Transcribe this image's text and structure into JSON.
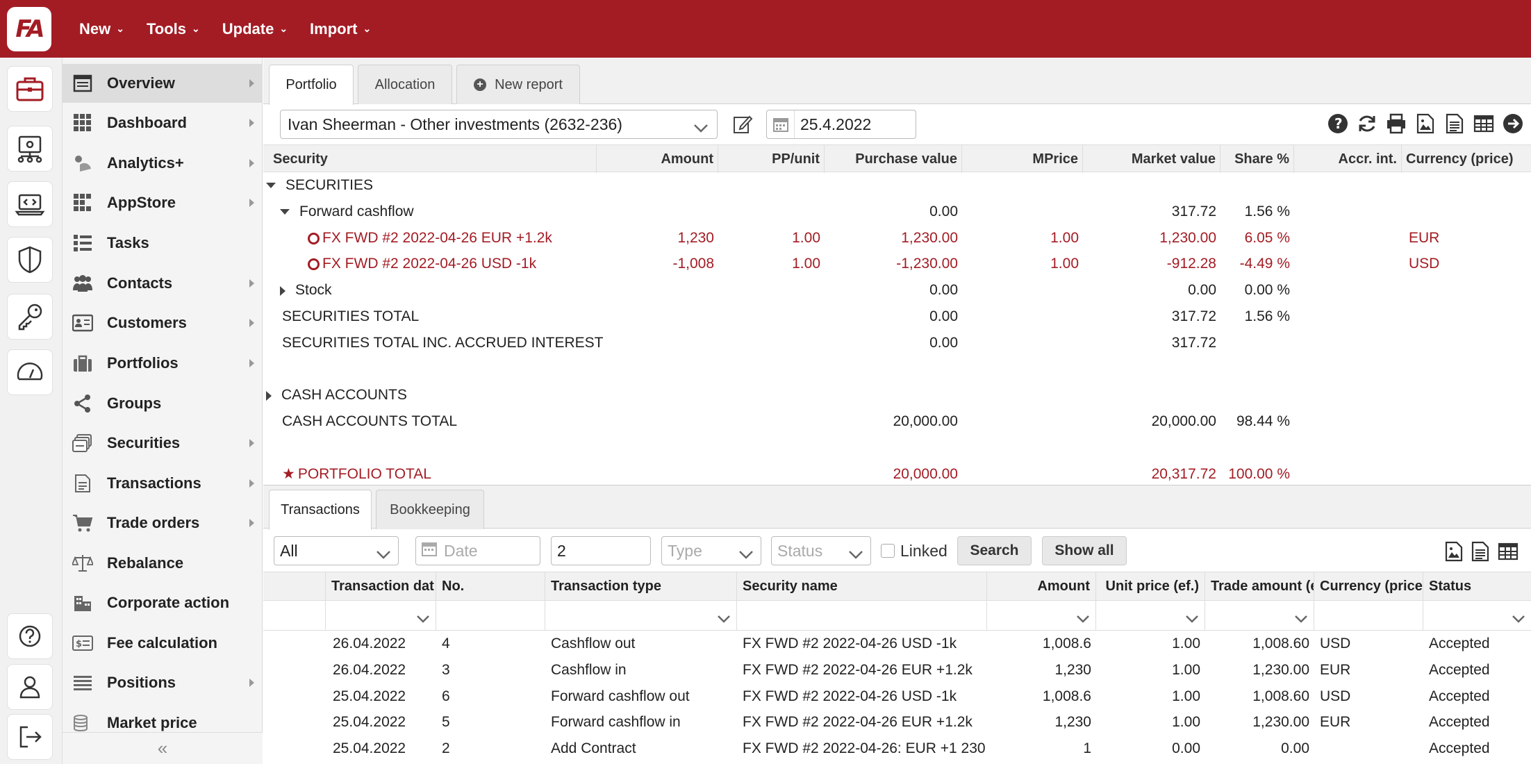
{
  "app": {
    "logo_text": "FA",
    "top_menu": [
      {
        "label": "New"
      },
      {
        "label": "Tools"
      },
      {
        "label": "Update"
      },
      {
        "label": "Import"
      }
    ]
  },
  "rail": {
    "items": [
      "briefcase-icon",
      "organization-icon",
      "code-laptop-icon",
      "shield-icon",
      "key-icon",
      "gauge-icon",
      "help-icon",
      "user-icon",
      "logout-icon"
    ]
  },
  "sidebar": {
    "items": [
      {
        "label": "Overview",
        "icon": "overview-icon",
        "arrow": true
      },
      {
        "label": "Dashboard",
        "icon": "dashboard-icon",
        "arrow": true
      },
      {
        "label": "Analytics+",
        "icon": "analytics-icon",
        "arrow": true
      },
      {
        "label": "AppStore",
        "icon": "appstore-icon",
        "arrow": true
      },
      {
        "label": "Tasks",
        "icon": "tasks-icon",
        "arrow": false
      },
      {
        "label": "Contacts",
        "icon": "contacts-icon",
        "arrow": true
      },
      {
        "label": "Customers",
        "icon": "customers-icon",
        "arrow": true
      },
      {
        "label": "Portfolios",
        "icon": "portfolios-icon",
        "arrow": true
      },
      {
        "label": "Groups",
        "icon": "groups-icon",
        "arrow": false
      },
      {
        "label": "Securities",
        "icon": "securities-icon",
        "arrow": true
      },
      {
        "label": "Transactions",
        "icon": "transactions-icon",
        "arrow": true
      },
      {
        "label": "Trade orders",
        "icon": "cart-icon",
        "arrow": true
      },
      {
        "label": "Rebalance",
        "icon": "scale-icon",
        "arrow": false
      },
      {
        "label": "Corporate action",
        "icon": "building-icon",
        "arrow": false
      },
      {
        "label": "Fee calculation",
        "icon": "fee-icon",
        "arrow": false
      },
      {
        "label": "Positions",
        "icon": "positions-icon",
        "arrow": true
      },
      {
        "label": "Market price",
        "icon": "coins-icon",
        "arrow": false
      }
    ],
    "collapse": "«"
  },
  "main_tabs": [
    {
      "label": "Portfolio"
    },
    {
      "label": "Allocation"
    },
    {
      "label": "New report"
    }
  ],
  "toolbar": {
    "portfolio": "Ivan Sheerman - Other investments (2632-236)",
    "date": "25.4.2022"
  },
  "portfolio_table": {
    "columns": [
      "Security",
      "Amount",
      "PP/unit",
      "Purchase value",
      "MPrice",
      "Market value",
      "Share %",
      "Accr. int.",
      "Currency (price)"
    ],
    "rows": [
      {
        "security": "SECURITIES",
        "indent": 0,
        "toggle": "down",
        "amount": "",
        "pp": "",
        "purchase": "",
        "mprice": "",
        "market": "",
        "share": "",
        "accr": "",
        "currency": "",
        "red": false
      },
      {
        "security": "Forward cashflow",
        "indent": 1,
        "toggle": "down",
        "amount": "",
        "pp": "",
        "purchase": "0.00",
        "mprice": "",
        "market": "317.72",
        "share": "1.56 %",
        "accr": "",
        "currency": "",
        "red": false
      },
      {
        "security": "FX FWD #2 2022-04-26 EUR +1.2k",
        "indent": 2,
        "toggle": "ring",
        "amount": "1,230",
        "pp": "1.00",
        "purchase": "1,230.00",
        "mprice": "1.00",
        "market": "1,230.00",
        "share": "6.05 %",
        "accr": "",
        "currency": "EUR",
        "red": true
      },
      {
        "security": "FX FWD #2 2022-04-26 USD -1k",
        "indent": 2,
        "toggle": "ring",
        "amount": "-1,008",
        "pp": "1.00",
        "purchase": "-1,230.00",
        "mprice": "1.00",
        "market": "-912.28",
        "share": "-4.49 %",
        "accr": "",
        "currency": "USD",
        "red": true
      },
      {
        "security": "Stock",
        "indent": 1,
        "toggle": "right",
        "amount": "",
        "pp": "",
        "purchase": "0.00",
        "mprice": "",
        "market": "0.00",
        "share": "0.00 %",
        "accr": "",
        "currency": "",
        "red": false
      },
      {
        "security": "SECURITIES TOTAL",
        "indent": 0,
        "toggle": "",
        "amount": "",
        "pp": "",
        "purchase": "0.00",
        "mprice": "",
        "market": "317.72",
        "share": "1.56 %",
        "accr": "",
        "currency": "",
        "red": false
      },
      {
        "security": "SECURITIES TOTAL INC. ACCRUED INTEREST",
        "indent": 0,
        "toggle": "",
        "amount": "",
        "pp": "",
        "purchase": "0.00",
        "mprice": "",
        "market": "317.72",
        "share": "",
        "accr": "",
        "currency": "",
        "red": false
      },
      {
        "security": "",
        "indent": 0,
        "toggle": "",
        "amount": "",
        "pp": "",
        "purchase": "",
        "mprice": "",
        "market": "",
        "share": "",
        "accr": "",
        "currency": "",
        "red": false
      },
      {
        "security": "CASH ACCOUNTS",
        "indent": 0,
        "toggle": "right",
        "amount": "",
        "pp": "",
        "purchase": "",
        "mprice": "",
        "market": "",
        "share": "",
        "accr": "",
        "currency": "",
        "red": false
      },
      {
        "security": "CASH ACCOUNTS TOTAL",
        "indent": 0,
        "toggle": "",
        "amount": "",
        "pp": "",
        "purchase": "20,000.00",
        "mprice": "",
        "market": "20,000.00",
        "share": "98.44 %",
        "accr": "",
        "currency": "",
        "red": false
      },
      {
        "security": "",
        "indent": 0,
        "toggle": "",
        "amount": "",
        "pp": "",
        "purchase": "",
        "mprice": "",
        "market": "",
        "share": "",
        "accr": "",
        "currency": "",
        "red": false
      },
      {
        "security": "PORTFOLIO TOTAL",
        "indent": 0,
        "toggle": "star",
        "amount": "",
        "pp": "",
        "purchase": "20,000.00",
        "mprice": "",
        "market": "20,317.72",
        "share": "100.00 %",
        "accr": "",
        "currency": "",
        "red": true
      }
    ]
  },
  "bottom_tabs": [
    {
      "label": "Transactions"
    },
    {
      "label": "Bookkeeping"
    }
  ],
  "filters": {
    "scope": "All",
    "date_placeholder": "Date",
    "number": "2",
    "type_placeholder": "Type",
    "status_placeholder": "Status",
    "linked_label": "Linked",
    "search_label": "Search",
    "show_all_label": "Show all"
  },
  "transactions": {
    "columns": [
      "",
      "Transaction dat",
      "No.",
      "Transaction type",
      "Security name",
      "Amount",
      "Unit price (ef.)",
      "Trade amount (e",
      "Currency (price",
      "Status"
    ],
    "rows": [
      {
        "date": "26.04.2022",
        "no": "4",
        "type": "Cashflow out",
        "security": "FX FWD #2 2022-04-26 USD -1k",
        "amount": "1,008.6",
        "unit": "1.00",
        "trade": "1,008.60",
        "currency": "USD",
        "status": "Accepted"
      },
      {
        "date": "26.04.2022",
        "no": "3",
        "type": "Cashflow in",
        "security": "FX FWD #2 2022-04-26 EUR +1.2k",
        "amount": "1,230",
        "unit": "1.00",
        "trade": "1,230.00",
        "currency": "EUR",
        "status": "Accepted"
      },
      {
        "date": "25.04.2022",
        "no": "6",
        "type": "Forward cashflow out",
        "security": "FX FWD #2 2022-04-26 USD -1k",
        "amount": "1,008.6",
        "unit": "1.00",
        "trade": "1,008.60",
        "currency": "USD",
        "status": "Accepted"
      },
      {
        "date": "25.04.2022",
        "no": "5",
        "type": "Forward cashflow in",
        "security": "FX FWD #2 2022-04-26 EUR +1.2k",
        "amount": "1,230",
        "unit": "1.00",
        "trade": "1,230.00",
        "currency": "EUR",
        "status": "Accepted"
      },
      {
        "date": "25.04.2022",
        "no": "2",
        "type": "Add Contract",
        "security": "FX FWD #2 2022-04-26: EUR +1 230",
        "amount": "1",
        "unit": "0.00",
        "trade": "0.00",
        "currency": "",
        "status": "Accepted"
      }
    ]
  },
  "colors": {
    "brand": "#a31c24",
    "active_tab_bg": "#ffffff",
    "panel_bg": "#f1f1f1"
  }
}
